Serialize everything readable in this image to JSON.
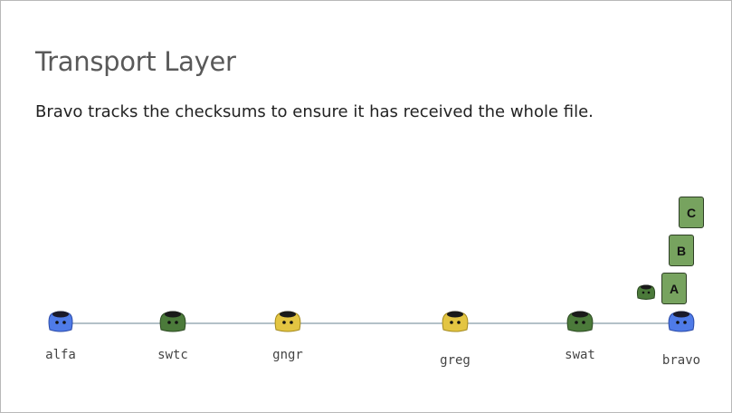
{
  "slide": {
    "title": "Transport Layer",
    "body": "Bravo tracks the checksums to ensure it has received the whole file."
  },
  "network": {
    "link_color": "#b3c1c8",
    "nodes": [
      {
        "id": "alfa",
        "label": "alfa",
        "color": "blue"
      },
      {
        "id": "swtc",
        "label": "swtc",
        "color": "green"
      },
      {
        "id": "gngr",
        "label": "gngr",
        "color": "yellow"
      },
      {
        "id": "greg",
        "label": "greg",
        "color": "yellow"
      },
      {
        "id": "swat",
        "label": "swat",
        "color": "green"
      },
      {
        "id": "bravo",
        "label": "bravo",
        "color": "blue"
      }
    ],
    "packets": [
      {
        "label": "C"
      },
      {
        "label": "B"
      },
      {
        "label": "A"
      }
    ]
  },
  "colors": {
    "blue": "#4f7be8",
    "green": "#4b7a3a",
    "yellow": "#e3c542",
    "packet_fill": "#77a35f"
  }
}
